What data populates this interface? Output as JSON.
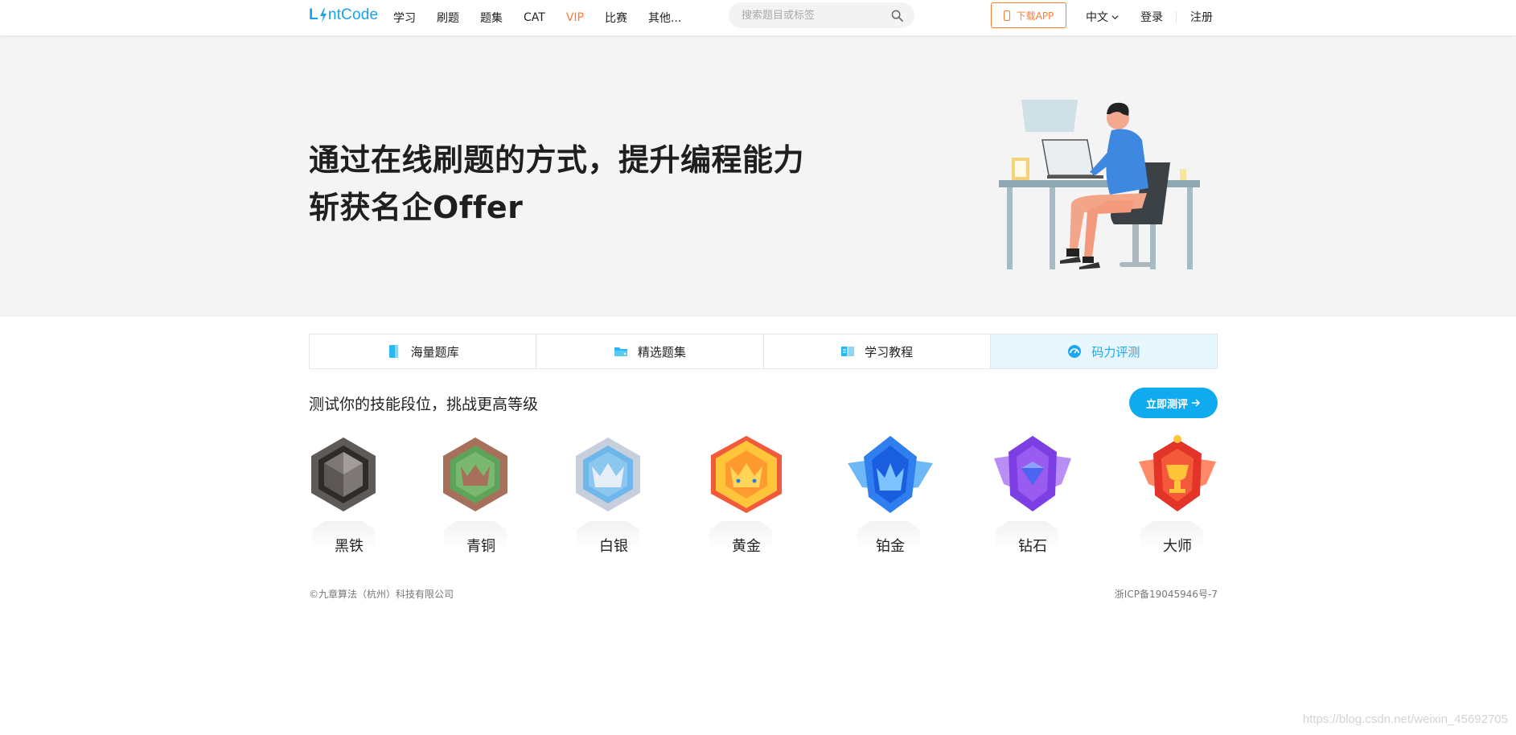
{
  "header": {
    "logo_prefix": "L",
    "logo_suffix": "ntCode",
    "nav": [
      "学习",
      "刷题",
      "题集",
      "CAT",
      "VIP",
      "比赛",
      "其他..."
    ],
    "search_placeholder": "搜索题目或标签",
    "download_label": "下载APP",
    "language": "中文",
    "login": "登录",
    "register": "注册"
  },
  "hero": {
    "line1": "通过在线刷题的方式，提升编程能力",
    "line2": "斩获名企Offer"
  },
  "tabs": [
    {
      "label": "海量题库",
      "icon": "book-icon"
    },
    {
      "label": "精选题集",
      "icon": "folder-icon"
    },
    {
      "label": "学习教程",
      "icon": "open-book-icon"
    },
    {
      "label": "码力评测",
      "icon": "gauge-icon",
      "active": true
    }
  ],
  "assessment": {
    "title": "测试你的技能段位，挑战更高等级",
    "button": "立即测评"
  },
  "badges": [
    {
      "label": "黑铁",
      "icon": "iron-badge-icon"
    },
    {
      "label": "青铜",
      "icon": "bronze-badge-icon"
    },
    {
      "label": "白银",
      "icon": "silver-badge-icon"
    },
    {
      "label": "黄金",
      "icon": "gold-badge-icon"
    },
    {
      "label": "铂金",
      "icon": "platinum-badge-icon"
    },
    {
      "label": "钻石",
      "icon": "diamond-badge-icon"
    },
    {
      "label": "大师",
      "icon": "master-badge-icon"
    }
  ],
  "footer": {
    "copyright": "©九章算法（杭州）科技有限公司",
    "icp": "浙ICP备19045946号-7"
  },
  "watermark": "https://blog.csdn.net/weixin_45692705",
  "colors": {
    "brand": "#1aa3e8",
    "accent_orange": "#ff7a32",
    "active_tab_bg": "#e8f6fd",
    "button_blue": "#10aaee"
  }
}
